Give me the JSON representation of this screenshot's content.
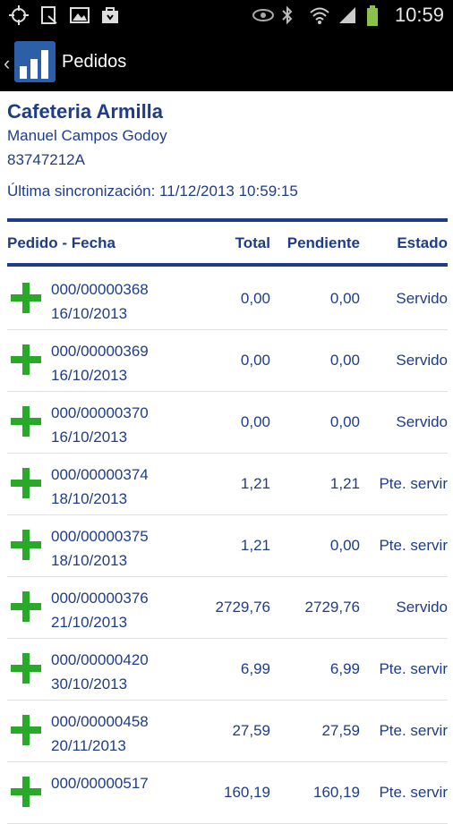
{
  "statusbar": {
    "time": "10:59"
  },
  "actionbar": {
    "title": "Pedidos"
  },
  "client": {
    "name": "Cafeteria Armilla",
    "contact": "Manuel Campos Godoy",
    "id": "83747212A",
    "sync": "Última sincronización: 11/12/2013 10:59:15"
  },
  "columns": {
    "pedido": "Pedido - Fecha",
    "total": "Total",
    "pendiente": "Pendiente",
    "estado": "Estado"
  },
  "orders": [
    {
      "num": "000/00000368",
      "date": "16/10/2013",
      "total": "0,00",
      "pendiente": "0,00",
      "estado": "Servido"
    },
    {
      "num": "000/00000369",
      "date": "16/10/2013",
      "total": "0,00",
      "pendiente": "0,00",
      "estado": "Servido"
    },
    {
      "num": "000/00000370",
      "date": "16/10/2013",
      "total": "0,00",
      "pendiente": "0,00",
      "estado": "Servido"
    },
    {
      "num": "000/00000374",
      "date": "18/10/2013",
      "total": "1,21",
      "pendiente": "1,21",
      "estado": "Pte. servir"
    },
    {
      "num": "000/00000375",
      "date": "18/10/2013",
      "total": "1,21",
      "pendiente": "0,00",
      "estado": "Pte. servir"
    },
    {
      "num": "000/00000376",
      "date": "21/10/2013",
      "total": "2729,76",
      "pendiente": "2729,76",
      "estado": "Servido"
    },
    {
      "num": "000/00000420",
      "date": "30/10/2013",
      "total": "6,99",
      "pendiente": "6,99",
      "estado": "Pte. servir"
    },
    {
      "num": "000/00000458",
      "date": "20/11/2013",
      "total": "27,59",
      "pendiente": "27,59",
      "estado": "Pte. servir"
    },
    {
      "num": "000/00000517",
      "date": "",
      "total": "160,19",
      "pendiente": "160,19",
      "estado": "Pte. servir"
    }
  ]
}
